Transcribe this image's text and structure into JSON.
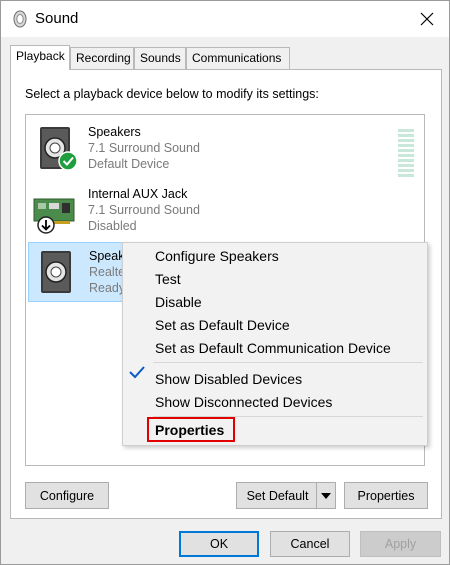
{
  "window": {
    "title": "Sound"
  },
  "tabs": [
    {
      "label": "Playback",
      "active": true
    },
    {
      "label": "Recording",
      "active": false
    },
    {
      "label": "Sounds",
      "active": false
    },
    {
      "label": "Communications",
      "active": false
    }
  ],
  "instruction": "Select a playback device below to modify its settings:",
  "devices": [
    {
      "name": "Speakers",
      "type": "7.1 Surround Sound",
      "status": "Default Device",
      "icon": "speaker-icon",
      "badge": "green-check-icon"
    },
    {
      "name": "Internal AUX Jack",
      "type": "7.1 Surround Sound",
      "status": "Disabled",
      "icon": "sound-card-icon",
      "badge": "down-arrow-icon"
    },
    {
      "name": "Speak",
      "type": "Realte",
      "status": "Ready",
      "icon": "speaker-icon",
      "selected": true
    }
  ],
  "context_menu": {
    "items": [
      {
        "label": "Configure Speakers"
      },
      {
        "label": "Test"
      },
      {
        "label": "Disable"
      },
      {
        "label": "Set as Default Device"
      },
      {
        "label": "Set as Default Communication Device"
      },
      {
        "label": "Show Disabled Devices",
        "checked": true
      },
      {
        "label": "Show Disconnected Devices"
      },
      {
        "label": "Properties",
        "bold": true,
        "highlighted": true
      }
    ]
  },
  "panel_buttons": {
    "configure": "Configure",
    "set_default": "Set Default",
    "properties": "Properties"
  },
  "dialog_buttons": {
    "ok": "OK",
    "cancel": "Cancel",
    "apply": "Apply"
  },
  "colors": {
    "selection": "#cce8ff",
    "highlight_border": "#e00000",
    "accent": "#0078d7",
    "check_green": "#1e9e3c"
  }
}
